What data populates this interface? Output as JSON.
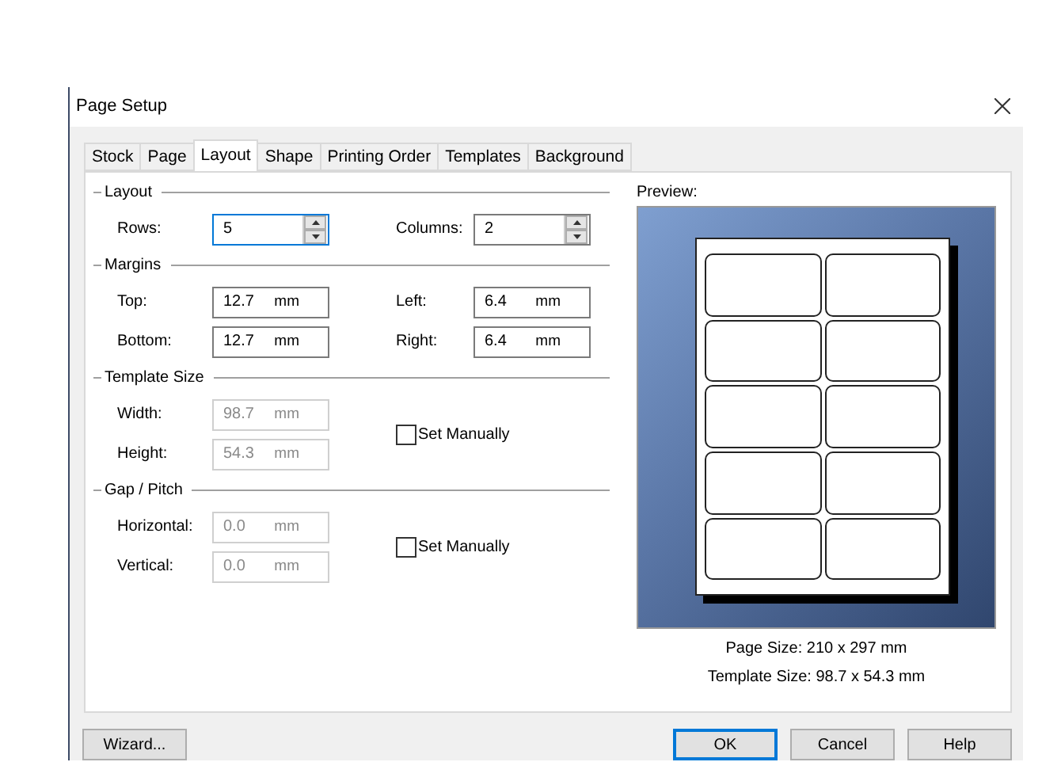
{
  "window": {
    "title": "Page Setup"
  },
  "tabs": [
    {
      "label": "Stock",
      "selected": false
    },
    {
      "label": "Page",
      "selected": false
    },
    {
      "label": "Layout",
      "selected": true
    },
    {
      "label": "Shape",
      "selected": false
    },
    {
      "label": "Printing Order",
      "selected": false
    },
    {
      "label": "Templates",
      "selected": false
    },
    {
      "label": "Background",
      "selected": false
    }
  ],
  "sections": [
    {
      "title": "Layout",
      "columns": [
        [
          {
            "kind": "spinner",
            "label": "Rows:",
            "value": "5",
            "disabled": false,
            "focused": true
          }
        ],
        [
          {
            "kind": "spinner",
            "label": "Columns:",
            "value": "2",
            "disabled": false,
            "focused": false
          }
        ]
      ]
    },
    {
      "title": "Margins",
      "columns": [
        [
          {
            "kind": "field",
            "label": "Top:",
            "value": "12.7",
            "unit": "mm",
            "disabled": false
          },
          {
            "kind": "field",
            "label": "Bottom:",
            "value": "12.7",
            "unit": "mm",
            "disabled": false
          }
        ],
        [
          {
            "kind": "field",
            "label": "Left:",
            "value": "6.4",
            "unit": "mm",
            "disabled": false
          },
          {
            "kind": "field",
            "label": "Right:",
            "value": "6.4",
            "unit": "mm",
            "disabled": false
          }
        ]
      ]
    },
    {
      "title": "Template Size",
      "columns": [
        [
          {
            "kind": "field",
            "label": "Width:",
            "value": "98.7",
            "unit": "mm",
            "disabled": true
          },
          {
            "kind": "field",
            "label": "Height:",
            "value": "54.3",
            "unit": "mm",
            "disabled": true
          }
        ],
        [
          {
            "kind": "checkbox",
            "label": "Set Manually",
            "checked": false
          }
        ]
      ]
    },
    {
      "title": "Gap / Pitch",
      "columns": [
        [
          {
            "kind": "field",
            "label": "Horizontal:",
            "value": "0.0",
            "unit": "mm",
            "disabled": true
          },
          {
            "kind": "field",
            "label": "Vertical:",
            "value": "0.0",
            "unit": "mm",
            "disabled": true
          }
        ],
        [
          {
            "kind": "checkbox",
            "label": "Set Manually",
            "checked": false
          }
        ]
      ]
    }
  ],
  "preview": {
    "label": "Preview:",
    "page_size": "Page Size:  210 x 297 mm",
    "template_size": "Template Size:  98.7 x 54.3 mm"
  },
  "buttons": [
    {
      "label": "Wizard...",
      "default": false
    },
    {
      "label": "OK",
      "default": true
    },
    {
      "label": "Cancel",
      "default": false
    },
    {
      "label": "Help",
      "default": false
    }
  ]
}
